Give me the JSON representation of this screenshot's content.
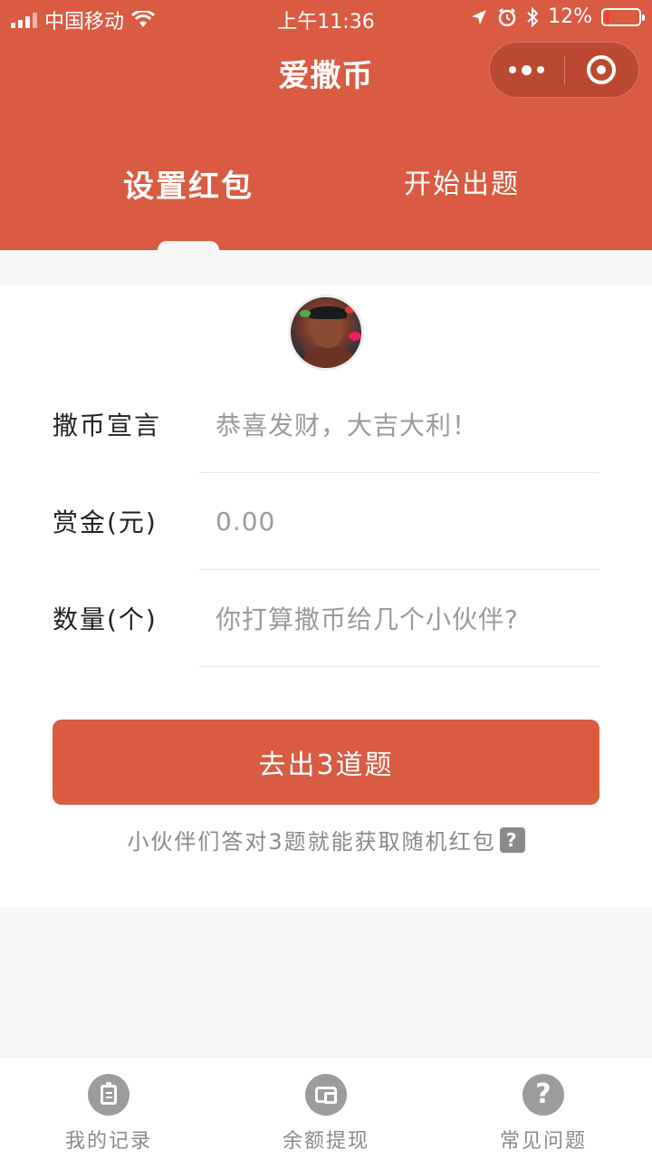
{
  "status_bar": {
    "carrier": "中国移动",
    "time": "上午11:36",
    "battery": "12%"
  },
  "nav": {
    "title": "爱撒币"
  },
  "tabs": [
    {
      "label": "设置红包",
      "active": true
    },
    {
      "label": "开始出题",
      "active": false
    }
  ],
  "form": {
    "fields": [
      {
        "label": "撒币宣言",
        "placeholder": "恭喜发财，大吉大利！"
      },
      {
        "label": "赏金(元)",
        "placeholder": "0.00"
      },
      {
        "label": "数量(个)",
        "placeholder": "你打算撒币给几个小伙伴?"
      }
    ],
    "submit_label": "去出3道题",
    "hint": "小伙伴们答对3题就能获取随机红包",
    "hint_icon": "?"
  },
  "tabbar": [
    {
      "label": "我的记录",
      "icon": "clipboard-icon"
    },
    {
      "label": "余额提现",
      "icon": "wallet-icon"
    },
    {
      "label": "常见问题",
      "icon": "question-icon"
    }
  ],
  "colors": {
    "brand": "#d95b42",
    "muted": "#8a8a8a"
  }
}
